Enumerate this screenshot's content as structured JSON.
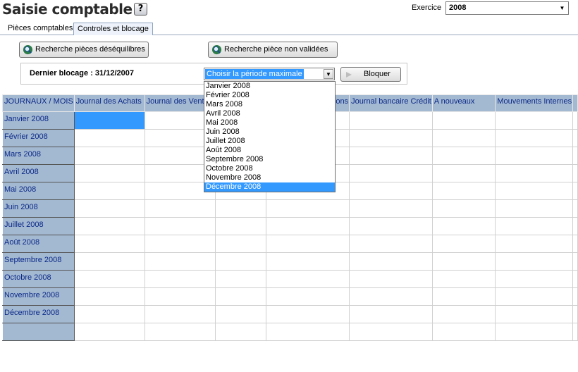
{
  "header": {
    "title": "Saisie comptable",
    "help_label": "?",
    "exercice_label": "Exercice",
    "exercice_value": "2008"
  },
  "tabs": [
    {
      "label": "Pièces comptables"
    },
    {
      "label": "Controles et blocage"
    }
  ],
  "panel": {
    "btn_deseq_label": "Recherche pièces déséquilibres",
    "btn_nonval_label": "Recherche pièce non validées",
    "dernier_blocage": "Dernier blocage : 31/12/2007",
    "period_selected": "Choisir la période maximale",
    "btn_bloquer_label": "Bloquer"
  },
  "dropdown": {
    "options": [
      "Janvier 2008",
      "Février 2008",
      "Mars 2008",
      "Avril 2008",
      "Mai 2008",
      "Juin 2008",
      "Juillet 2008",
      "Août 2008",
      "Septembre 2008",
      "Octobre 2008",
      "Novembre 2008",
      "Décembre 2008"
    ],
    "highlighted": "Décembre 2008"
  },
  "grid": {
    "corner": "JOURNAUX / MOIS",
    "columns": [
      "Journal des Achats",
      "Journal des Ventes",
      "",
      "Journal des Opérations",
      "Journal bancaire Crédit",
      "A nouveaux",
      "Mouvements Internes",
      ""
    ],
    "rows": [
      "Janvier 2008",
      "Février 2008",
      "Mars 2008",
      "Avril 2008",
      "Mai 2008",
      "Juin 2008",
      "Juillet 2008",
      "Août 2008",
      "Septembre 2008",
      "Octobre 2008",
      "Novembre 2008",
      "Décembre 2008",
      ""
    ]
  },
  "colors": {
    "header_bg": "#a3b8d1",
    "header_text": "#0b2a88",
    "selection": "#3399ff"
  }
}
